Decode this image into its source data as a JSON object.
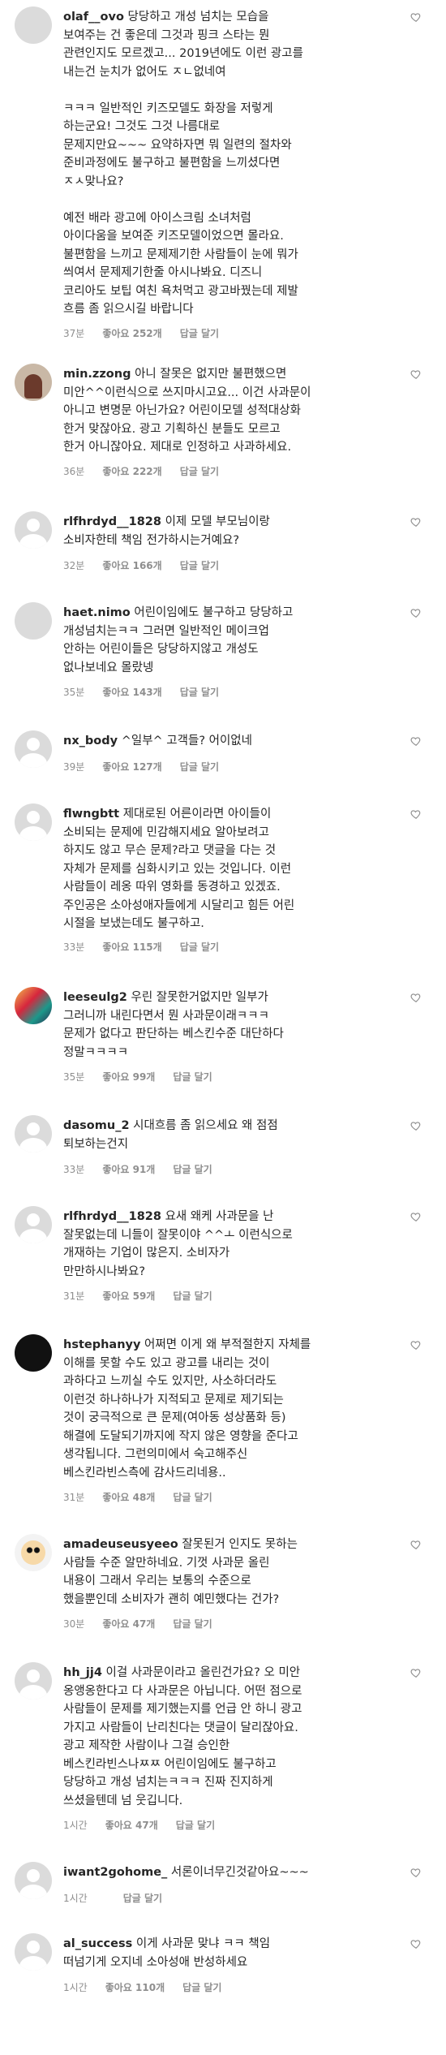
{
  "reply_label": "답글 달기",
  "comments": [
    {
      "username": "olaf__ovo",
      "text": "당당하고 개성 넘치는 모습을\n보여주는 건 좋은데 그것과 핑크 스타는 뭔\n관련인지도 모르겠고... 2019년에도 이런 광고를\n내는건 눈치가 없어도 ㅈㄴ없네여\n\nㅋㅋㅋ 일반적인 키즈모델도 화장을 저렇게\n하는군요! 그것도 그것 나름대로\n문제지만요~~~ 요약하자면 뭐 일련의 절차와\n준비과정에도 불구하고 불편함을 느끼셨다면\nㅈㅅ맞나요?\n\n예전 배라 광고에 아이스크림 소녀처럼\n아이다움을 보여준 키즈모델이었으면 몰라요.\n불편함을 느끼고 문제제기한 사람들이 눈에 뭐가\n씌여서 문제제기한줄 아시나봐요. 디즈니\n코리아도 보팁 여친 욕처먹고 광고바꿨는데 제발\n흐름 좀 읽으시길 바랍니다",
      "time": "37분",
      "likes": "좋아요 252개"
    },
    {
      "username": "min.zzong",
      "text": "아니 잘못은 없지만 불편했으면\n미안^^이런식으로 쓰지마시고요... 이건 사과문이\n아니고 변명문 아닌가요? 어린이모델 성적대상화\n한거 맞잖아요. 광고 기획하신 분들도 모르고\n한거 아니잖아요. 제대로 인정하고 사과하세요.",
      "time": "36분",
      "likes": "좋아요 222개"
    },
    {
      "username": "rlfhrdyd__1828",
      "text": "이제 모델 부모님이랑\n소비자한테 책임 전가하시는거예요?",
      "time": "32분",
      "likes": "좋아요 166개"
    },
    {
      "username": "haet.nimo",
      "text": "어린이임에도 불구하고 당당하고\n개성넘치는ㅋㅋ 그러면 일반적인 메이크업\n안하는 어린이들은 당당하지않고 개성도\n없나보네요 몰랐넹",
      "time": "35분",
      "likes": "좋아요 143개"
    },
    {
      "username": "nx_body",
      "text": "^일부^ 고객들? 어이없네",
      "time": "39분",
      "likes": "좋아요 127개"
    },
    {
      "username": "flwngbtt",
      "text": "제대로된 어른이라면 아이들이\n소비되는 문제에 민감해지세요 알아보려고\n하지도 않고 무슨 문제?라고 댓글을 다는 것\n자체가 문제를 심화시키고 있는 것입니다. 이런\n사람들이 레옹 따위 영화를 동경하고 있겠죠.\n주인공은 소아성애자들에게 시달리고 힘든 어린\n시절을 보냈는데도 불구하고.",
      "time": "33분",
      "likes": "좋아요 115개"
    },
    {
      "username": "leeseulg2",
      "text": "우린 잘못한거없지만 일부가\n그러니까 내린다면서 뭔 사과문이래ㅋㅋㅋ\n문제가 없다고 판단하는 베스킨수준 대단하다\n정말ㅋㅋㅋㅋ",
      "time": "35분",
      "likes": "좋아요 99개"
    },
    {
      "username": "dasomu_2",
      "text": "시대흐름 좀 읽으세요 왜 점점\n퇴보하는건지",
      "time": "33분",
      "likes": "좋아요 91개"
    },
    {
      "username": "rlfhrdyd__1828",
      "text": "요새 왜케 사과문을 난\n잘못없는데 니들이 잘못이야 ^^ㅗ 이런식으로\n개재하는 기업이 많은지. 소비자가\n만만하시나봐요?",
      "time": "31분",
      "likes": "좋아요 59개"
    },
    {
      "username": "hstephanyy",
      "text": "어쩌면 이게 왜 부적절한지 자체를\n이해를 못할 수도 있고 광고를 내리는 것이\n과하다고 느끼실 수도 있지만, 사소하더라도\n이런것 하나하나가 지적되고 문제로 제기되는\n것이 궁극적으로 큰 문제(여아동 성상품화 등)\n해결에 도달되기까지에 작지 않은 영향을 준다고\n생각됩니다. 그런의미에서 숙고해주신\n베스킨라빈스측에 감사드리네용..",
      "time": "31분",
      "likes": "좋아요 48개"
    },
    {
      "username": "amadeuseusyeeo",
      "text": "잘못된거 인지도 못하는\n사람들 수준 알만하네요. 기껏 사과문 올린\n내용이 그래서 우리는 보통의 수준으로\n했을뿐인데 소비자가 괜히 예민했다는 건가?",
      "time": "30분",
      "likes": "좋아요 47개"
    },
    {
      "username": "hh_jj4",
      "text": "이걸 사과문이라고 올린건가요? 오 미안\n옹앵옹한다고 다 사과문은 아닙니다. 어떤 점으로\n사람들이 문제를 제기했는지를 언급 안 하니 광고\n가지고 사람들이 난리친다는 댓글이 달리잖아요.\n광고 제작한 사람이나 그걸 승인한\n베스킨라빈스나ㅉㅉ 어린이임에도 불구하고\n당당하고 개성 넘치는ㅋㅋㅋ 진짜 진지하게\n쓰셨을텐데 넘 웃깁니다.",
      "time": "1시간",
      "likes": "좋아요 47개"
    },
    {
      "username": "iwant2gohome_",
      "text": "서론이너무긴것같아요~~~",
      "time": "1시간",
      "likes": ""
    },
    {
      "username": "al_success",
      "text": "이게 사과문 맞냐 ㅋㅋ 책임\n떠넘기게 오지네 소아성애 반성하세요",
      "time": "1시간",
      "likes": "좋아요 110개"
    }
  ]
}
